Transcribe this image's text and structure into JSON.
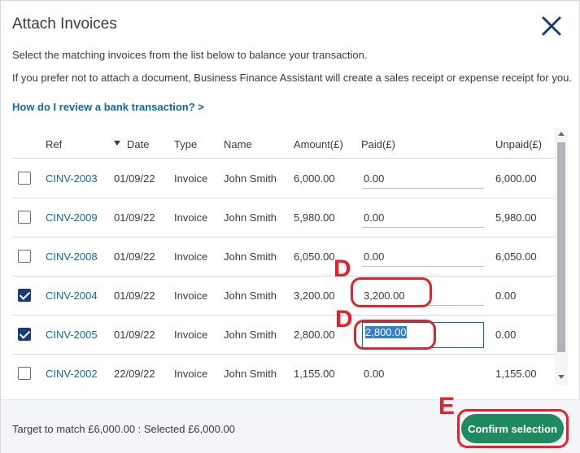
{
  "dialog": {
    "title": "Attach Invoices",
    "description_1": "Select the matching invoices from the list below to balance your transaction.",
    "description_2": "If you prefer not to attach a document, Business Finance Assistant will create a sales receipt or expense receipt for you.",
    "help_link": "How do I review a bank transaction? >"
  },
  "table": {
    "headers": {
      "ref": "Ref",
      "date": "Date",
      "type": "Type",
      "name": "Name",
      "amount": "Amount(£)",
      "paid": "Paid(£)",
      "unpaid": "Unpaid(£)"
    },
    "rows": [
      {
        "checked": false,
        "ref": "CINV-2003",
        "date": "01/09/22",
        "type": "Invoice",
        "name": "John Smith",
        "amount": "6,000.00",
        "paid": "0.00",
        "unpaid": "6,000.00"
      },
      {
        "checked": false,
        "ref": "CINV-2009",
        "date": "01/09/22",
        "type": "Invoice",
        "name": "John Smith",
        "amount": "5,980.00",
        "paid": "0.00",
        "unpaid": "5,980.00"
      },
      {
        "checked": false,
        "ref": "CINV-2008",
        "date": "01/09/22",
        "type": "Invoice",
        "name": "John Smith",
        "amount": "6,050.00",
        "paid": "0.00",
        "unpaid": "6,050.00"
      },
      {
        "checked": true,
        "ref": "CINV-2004",
        "date": "01/09/22",
        "type": "Invoice",
        "name": "John Smith",
        "amount": "3,200.00",
        "paid": "3,200.00",
        "unpaid": "0.00"
      },
      {
        "checked": true,
        "ref": "CINV-2005",
        "date": "01/09/22",
        "type": "Invoice",
        "name": "John Smith",
        "amount": "2,800.00",
        "paid": "2,800.00",
        "unpaid": "0.00"
      },
      {
        "checked": false,
        "ref": "CINV-2002",
        "date": "22/09/22",
        "type": "Invoice",
        "name": "John Smith",
        "amount": "1,155.00",
        "paid": "0.00",
        "unpaid": "1,155.00"
      }
    ]
  },
  "footer": {
    "target_text": "Target to match  £6,000.00  :  Selected  £6,000.00",
    "confirm_label": "Confirm selection"
  },
  "annotations": {
    "d_label": "D",
    "e_label": "E",
    "color": "#e3222b"
  },
  "colors": {
    "link": "#0d6b9e",
    "confirm": "#1f8a5f",
    "checkbox_checked": "#1a3b7a"
  },
  "icons": {
    "close": "close-icon",
    "sort": "sort-descending-icon"
  }
}
